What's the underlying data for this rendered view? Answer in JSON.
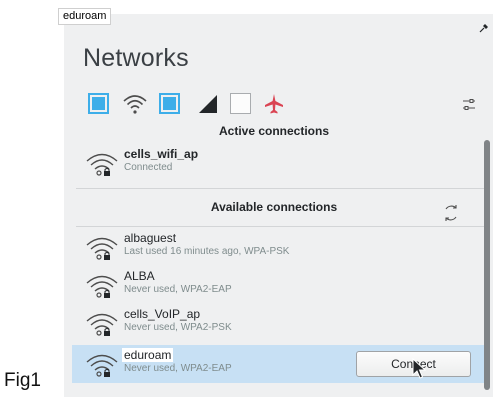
{
  "figure_label": "Fig1",
  "tooltip": {
    "text": "eduroam"
  },
  "panel": {
    "title": "Networks"
  },
  "toolbar": {
    "icons": [
      "wifi-toggle",
      "wifi-icon",
      "mobile-toggle",
      "signal-icon",
      "airplane-toggle",
      "airplane-icon",
      "settings-icon"
    ]
  },
  "sections": {
    "active": "Active connections",
    "available": "Available connections"
  },
  "active_networks": [
    {
      "name": "cells_wifi_ap",
      "status": "Connected"
    }
  ],
  "available_networks": [
    {
      "name": "albaguest",
      "status": "Last used 16 minutes ago, WPA-PSK"
    },
    {
      "name": "ALBA",
      "status": "Never used, WPA2-EAP"
    },
    {
      "name": "cells_VoIP_ap",
      "status": "Never used, WPA2-PSK"
    },
    {
      "name": "eduroam",
      "status": "Never used, WPA2-EAP"
    }
  ],
  "buttons": {
    "connect": "Connect"
  },
  "colors": {
    "accent": "#3daee9",
    "selected_row": "#c7e0f4",
    "airplane": "#da4453",
    "panel_bg": "#eff0f1"
  }
}
